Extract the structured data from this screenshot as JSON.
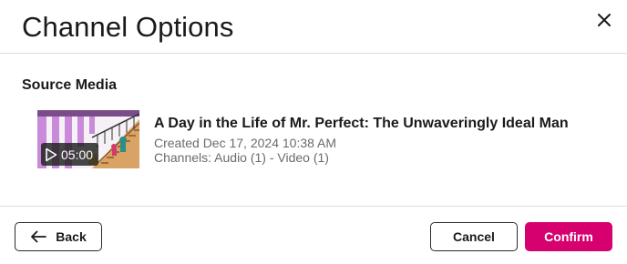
{
  "dialog": {
    "title": "Channel Options",
    "close_icon": "close-icon"
  },
  "source_media": {
    "section_title": "Source Media",
    "item": {
      "title": "A Day in the Life of Mr. Perfect: The Unwaveringly Ideal Man",
      "created": "Created Dec 17, 2024 10:38 AM",
      "channels": "Channels: Audio (1) - Video (1)",
      "duration": "05:00",
      "play_icon": "play-icon"
    }
  },
  "footer": {
    "back_label": "Back",
    "back_icon": "arrow-left-icon",
    "cancel_label": "Cancel",
    "confirm_label": "Confirm"
  },
  "colors": {
    "accent": "#d6006f",
    "text": "#1a1a1a",
    "muted": "#6b6b6b",
    "divider": "#dcdcdc"
  }
}
